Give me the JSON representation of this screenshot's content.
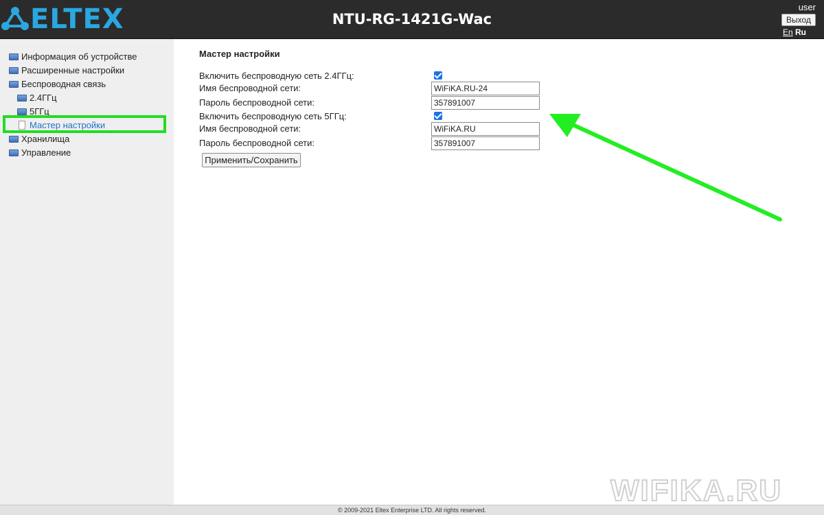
{
  "header": {
    "logo_text": "ELTEX",
    "model": "NTU-RG-1421G-Wac",
    "username": "user",
    "logout_label": "Выход",
    "lang_en": "En",
    "lang_ru": "Ru"
  },
  "sidebar": {
    "items": [
      {
        "label": "Информация об устройстве",
        "icon": "folder-icon"
      },
      {
        "label": "Расширенные настройки",
        "icon": "folder-icon"
      },
      {
        "label": "Беспроводная связь",
        "icon": "folder-icon"
      },
      {
        "label": "2.4ГГц",
        "icon": "folder-icon"
      },
      {
        "label": "5ГГц",
        "icon": "folder-icon"
      },
      {
        "label": "Мастер настройки",
        "icon": "page-icon",
        "active": true
      },
      {
        "label": "Хранилища",
        "icon": "folder-icon"
      },
      {
        "label": "Управление",
        "icon": "folder-icon"
      }
    ]
  },
  "main": {
    "title": "Мастер настройки",
    "rows": [
      {
        "label": "Включить беспроводную сеть 2.4ГГц:",
        "type": "checkbox",
        "checked": true
      },
      {
        "label": "Имя беспроводной сети:",
        "type": "text",
        "value": "WiFiKA.RU-24"
      },
      {
        "label": "Пароль беспроводной сети:",
        "type": "text",
        "value": "357891007"
      },
      {
        "label": "Включить беспроводную сеть 5ГГц:",
        "type": "checkbox",
        "checked": true
      },
      {
        "label": "Имя беспроводной сети:",
        "type": "text",
        "value": "WiFiKA.RU"
      },
      {
        "label": "Пароль беспроводной сети:",
        "type": "text",
        "value": "357891007"
      }
    ],
    "apply_label": "Применить/Сохранить"
  },
  "footer": {
    "copyright": "© 2009-2021 Eltex Enterprise LTD. All rights reserved."
  },
  "watermark": {
    "text": "WIFIKA.RU"
  },
  "colors": {
    "header_bg": "#2b2b2b",
    "logo_blue": "#2aa7e0",
    "sidebar_bg": "#efefef",
    "active_link": "#1e73c8",
    "highlight_green": "#22dd22",
    "checkbox_blue": "#1a73e8"
  }
}
